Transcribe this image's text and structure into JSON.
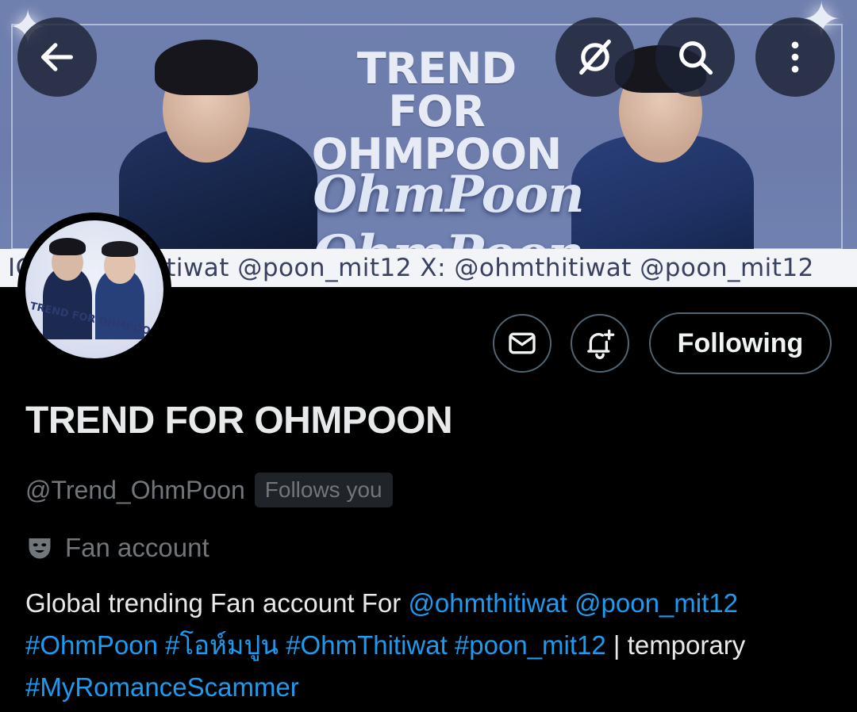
{
  "banner": {
    "title_line1": "TREND",
    "title_line2": "FOR",
    "title_line3": "OHMPOON",
    "script_text": "OhmPoon OhmPoon",
    "strip_text": "IG: @ohmthitiwat @poon_mit12 X: @ohmthitiwat @poon_mit12"
  },
  "topbar": {
    "back_icon": "arrow-left-icon",
    "grok_icon": "grok-icon",
    "search_icon": "search-icon",
    "more_icon": "more-vertical-icon"
  },
  "avatar": {
    "label": "TREND FOR OHMPOON"
  },
  "actions": {
    "message_icon": "envelope-icon",
    "notify_icon": "bell-plus-icon",
    "follow_label": "Following"
  },
  "profile": {
    "display_name": "TREND FOR OHMPOON",
    "handle": "@Trend_OhmPoon",
    "follows_you": "Follows you",
    "category_icon": "theater-masks-icon",
    "category": "Fan account",
    "bio": {
      "text1": "Global trending Fan account For ",
      "mention1": "@ohmthitiwat",
      "space1": " ",
      "mention2": "@poon_mit12",
      "tag1": "#OhmPoon",
      "tag2": "#โอห์มปูน",
      "tag3": "#OhmThitiwat",
      "tag4": "#poon_mit12",
      "text2": " | temporary",
      "tag5": "#MyRomanceScammer"
    }
  },
  "colors": {
    "background": "#000000",
    "link": "#1d9bf0",
    "secondary_text": "#71767b",
    "border": "#536471"
  }
}
